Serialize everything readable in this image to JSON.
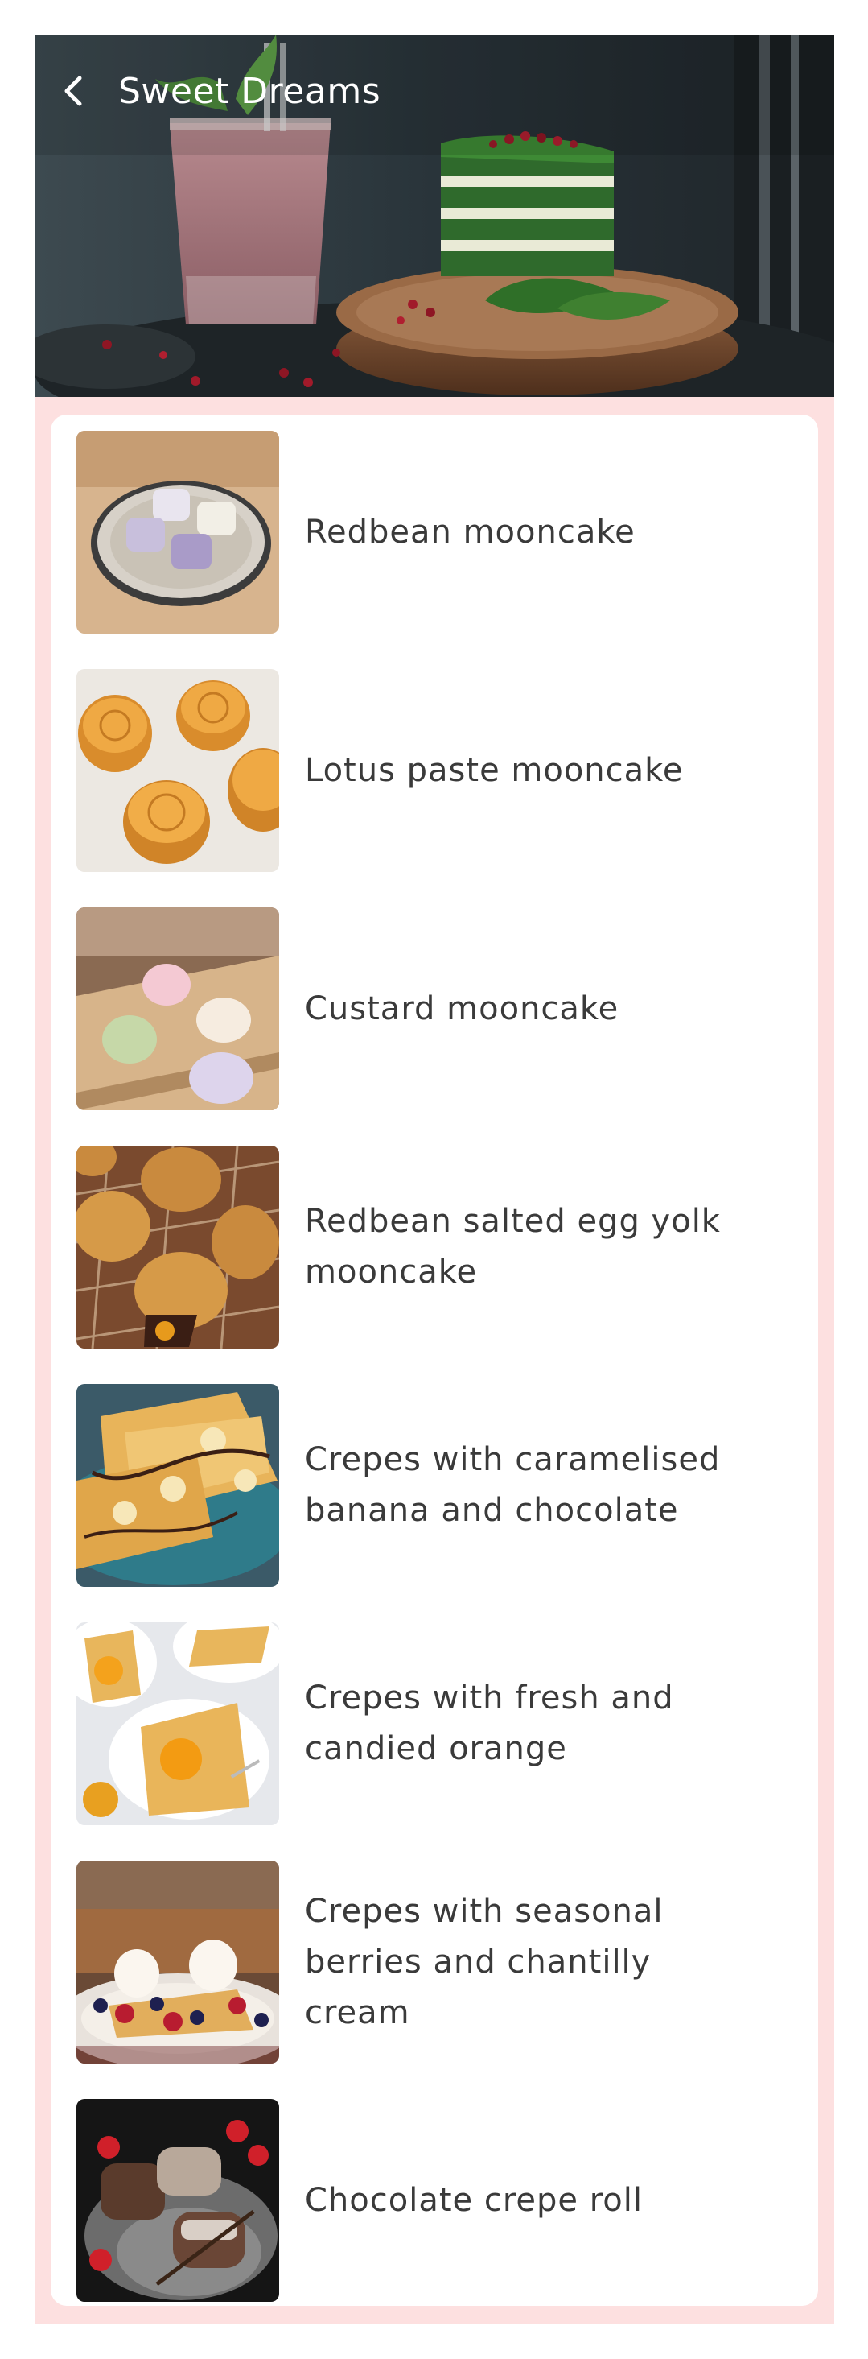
{
  "header": {
    "title": "Sweet Dreams",
    "back_icon": "chevron-left-icon"
  },
  "colors": {
    "frame": "#fde0e0",
    "card": "#ffffff",
    "text": "#3a3a3a",
    "title": "#ffffff"
  },
  "items": [
    {
      "label": "Redbean mooncake",
      "image": "redbean-mooncake-photo"
    },
    {
      "label": "Lotus paste mooncake",
      "image": "lotus-mooncake-photo"
    },
    {
      "label": "Custard mooncake",
      "image": "custard-mooncake-photo"
    },
    {
      "label": "Redbean salted egg yolk mooncake",
      "image": "salted-egg-mooncake-photo"
    },
    {
      "label": "Crepes with caramelised banana and chocolate",
      "image": "banana-crepes-photo"
    },
    {
      "label": "Crepes with fresh and candied orange",
      "image": "orange-crepes-photo"
    },
    {
      "label": "Crepes with seasonal berries and chantilly cream",
      "image": "berry-crepes-photo"
    },
    {
      "label": "Chocolate crepe roll",
      "image": "chocolate-crepe-roll-photo"
    }
  ]
}
